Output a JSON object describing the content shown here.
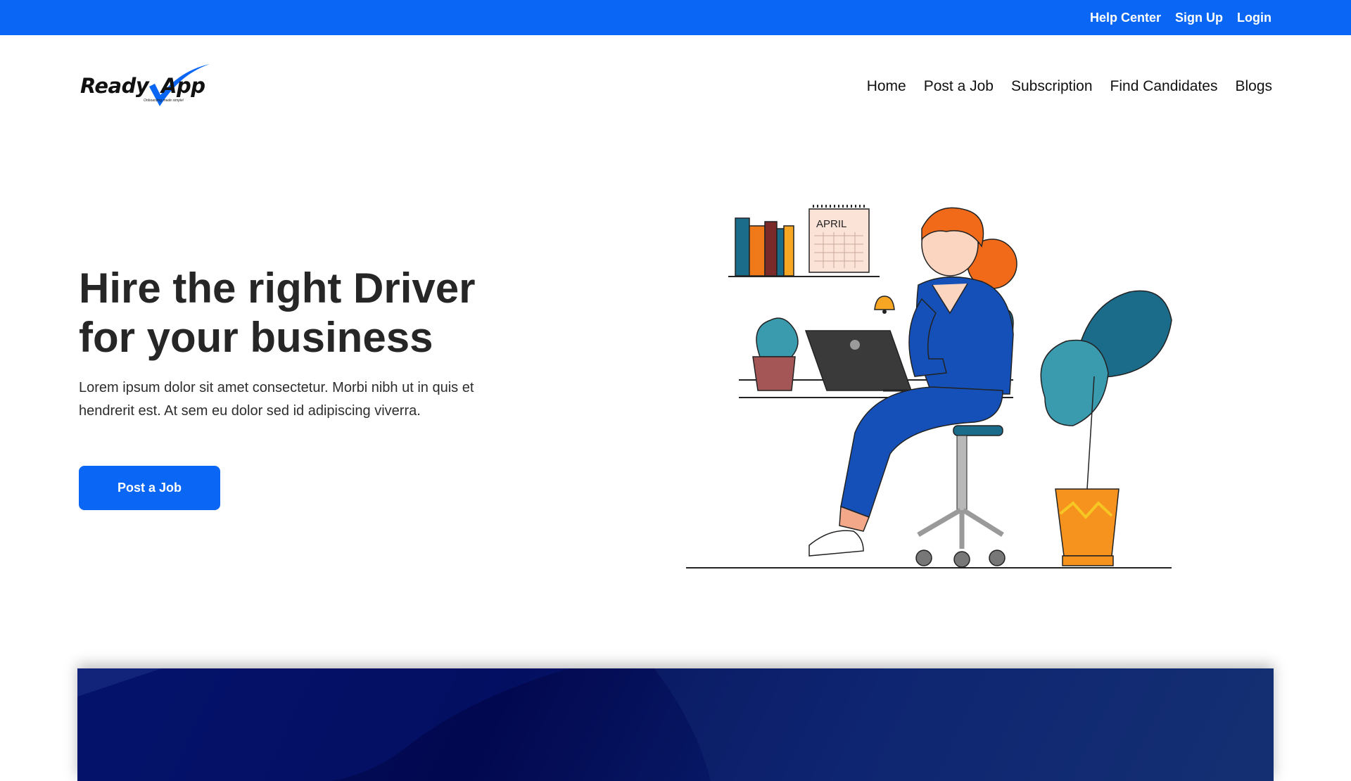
{
  "topbar": {
    "links": [
      "Help Center",
      "Sign Up",
      "Login"
    ]
  },
  "logo": {
    "word1": "Ready",
    "word2": "App",
    "tagline": "Onboarding made simple!"
  },
  "nav": {
    "items": [
      "Home",
      "Post a Job",
      "Subscription",
      "Find Candidates",
      "Blogs"
    ]
  },
  "hero": {
    "title_line1": "Hire the right Driver",
    "title_line2": "for your business",
    "description_line1": "Lorem ipsum dolor sit amet consectetur. Morbi nibh ut in quis et",
    "description_line2": "hendrerit est. At sem eu dolor sed id adipiscing viverra.",
    "cta_label": "Post a Job"
  },
  "illustration": {
    "calendar_month": "APRIL"
  },
  "colors": {
    "brand_blue": "#0a66f5",
    "banner_navy": "#02084f"
  }
}
